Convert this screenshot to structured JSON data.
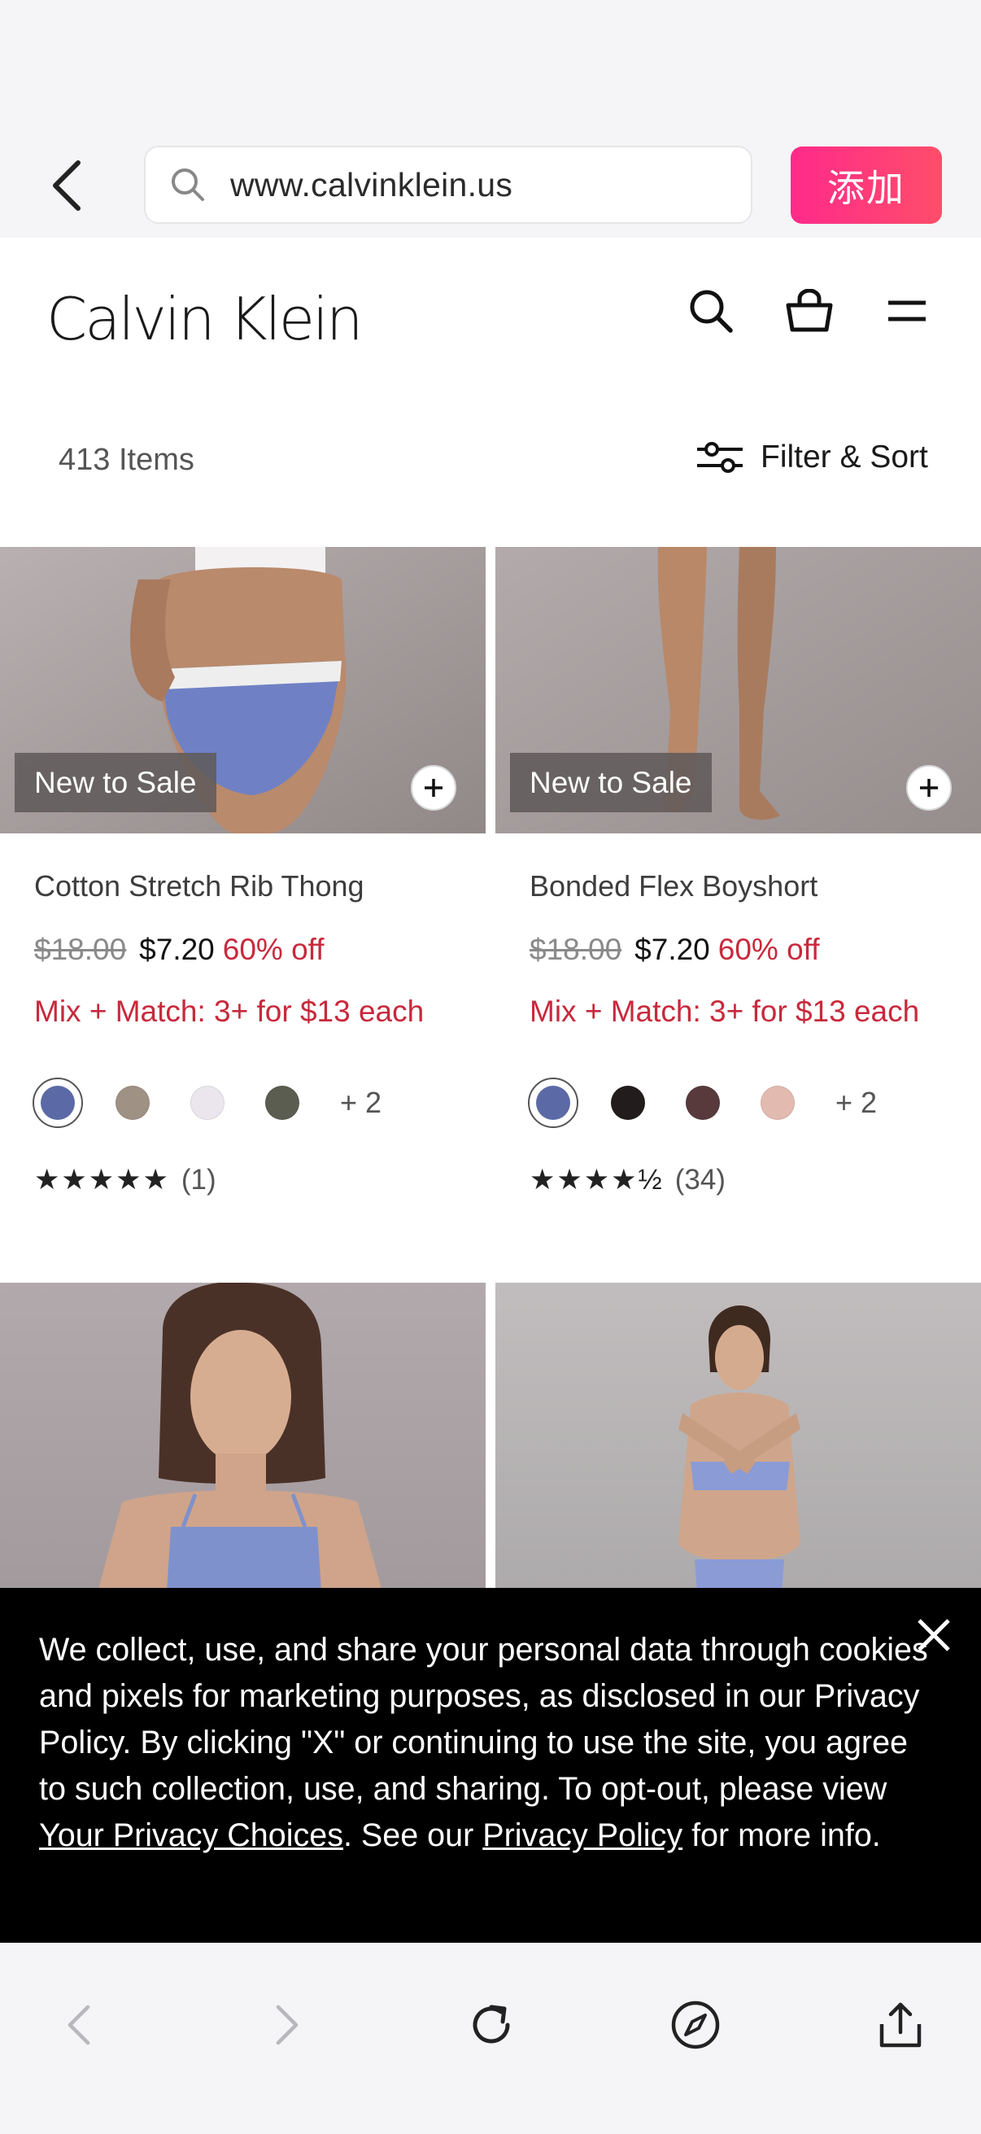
{
  "browser": {
    "url": "www.calvinklein.us",
    "add_button": "添加"
  },
  "site": {
    "logo": "Calvin Klein"
  },
  "listing": {
    "count": "413 Items",
    "filter_label": "Filter & Sort"
  },
  "products": [
    {
      "badge": "New to Sale",
      "name": "Cotton Stretch Rib Thong",
      "was_price": "$18.00",
      "price": "$7.20",
      "discount": "60% off",
      "promo": "Mix + Match: 3+ for $13 each",
      "swatches": [
        "#5b6aa6",
        "#a09185",
        "#ebe6ee",
        "#5a5d50"
      ],
      "more_colors": "+ 2",
      "stars": "★★★★★",
      "review_count": "(1)"
    },
    {
      "badge": "New to Sale",
      "name": "Bonded Flex Boyshort",
      "was_price": "$18.00",
      "price": "$7.20",
      "discount": "60% off",
      "promo": "Mix + Match: 3+ for $13 each",
      "swatches": [
        "#5b6aa6",
        "#221c1c",
        "#583a3c",
        "#e3bab0"
      ],
      "more_colors": "+ 2",
      "stars": "★★★★½",
      "review_count": "(34)"
    }
  ],
  "cookie": {
    "text_1": "We collect, use, and share your personal data through cookies and pixels for marketing purposes, as disclosed in our Privacy Policy. By clicking \"X\" or continuing to use the site, you agree to such collection, use, and sharing. To opt-out, please view ",
    "link_choices": "Your Privacy Choices",
    "text_2": ". See our ",
    "link_policy": "Privacy Policy",
    "text_3": " for more info."
  },
  "colors": {
    "sale_red": "#c8293c",
    "add_button_gradient": [
      "#ff2a8a",
      "#ff4d6a"
    ],
    "browser_chrome": "#f5f5f7"
  }
}
